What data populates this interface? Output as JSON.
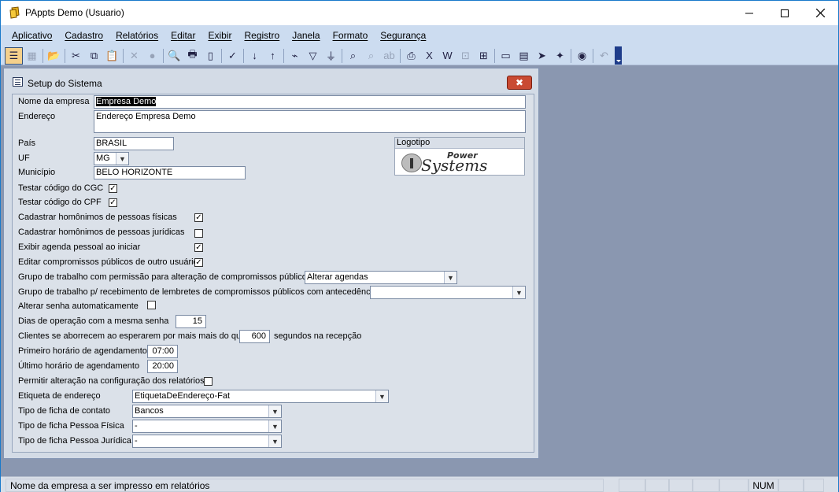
{
  "window": {
    "title": "PAppts Demo (Usuario)"
  },
  "menu": [
    "Aplicativo",
    "Cadastro",
    "Relatórios",
    "Editar",
    "Exibir",
    "Registro",
    "Janela",
    "Formato",
    "Segurança"
  ],
  "child_window": {
    "title": "Setup do Sistema",
    "close_glyph": "✖"
  },
  "form": {
    "nome_empresa": {
      "label": "Nome da empresa",
      "value": "Empresa Demo"
    },
    "endereco": {
      "label": "Endereço",
      "value": "Endereço Empresa Demo"
    },
    "pais": {
      "label": "País",
      "value": "BRASIL"
    },
    "uf": {
      "label": "UF",
      "value": "MG"
    },
    "municipio": {
      "label": "Município",
      "value": "BELO HORIZONTE"
    },
    "logotipo": {
      "label": "Logotipo",
      "logo_power": "Power",
      "logo_systems": "Systems"
    },
    "testar_cgc": {
      "label": "Testar código do CGC",
      "checked": true
    },
    "testar_cpf": {
      "label": "Testar código do CPF",
      "checked": true
    },
    "homonimos_fisicas": {
      "label": "Cadastrar homônimos de pessoas físicas",
      "checked": true
    },
    "homonimos_juridicas": {
      "label": "Cadastrar homônimos de pessoas jurídicas",
      "checked": false
    },
    "exibir_agenda": {
      "label": "Exibir agenda pessoal ao iniciar",
      "checked": true
    },
    "editar_compromissos": {
      "label": "Editar compromissos públicos de outro usuário",
      "checked": true
    },
    "grupo_alteracao": {
      "label": "Grupo de trabalho com permissão para alteração de compromissos públicos",
      "value": "Alterar agendas"
    },
    "grupo_lembretes": {
      "label": "Grupo de trabalho p/ recebimento de lembretes de compromissos públicos com antecedência",
      "value": ""
    },
    "alterar_senha": {
      "label": "Alterar senha automaticamente",
      "checked": false
    },
    "dias_operacao": {
      "label": "Dias de operação com a mesma senha",
      "value": "15"
    },
    "clientes_aborrecem": {
      "label": "Clientes se aborrecem ao esperarem por mais mais do que",
      "value": "600",
      "suffix": "segundos na recepção"
    },
    "primeiro_horario": {
      "label": "Primeiro horário de agendamento",
      "value": "07:00"
    },
    "ultimo_horario": {
      "label": "Último horário de agendamento",
      "value": "20:00"
    },
    "permitir_alteracao": {
      "label": "Permitir alteração na configuração dos relatórios",
      "checked": false
    },
    "etiqueta_endereco": {
      "label": "Etiqueta de endereço",
      "value": "EtiquetaDeEndereço-Fat"
    },
    "tipo_ficha_contato": {
      "label": "Tipo de ficha de contato",
      "value": "Bancos"
    },
    "tipo_ficha_fisica": {
      "label": "Tipo de ficha Pessoa Física",
      "value": "-"
    },
    "tipo_ficha_juridica": {
      "label": "Tipo de ficha Pessoa Jurídica",
      "value": "-"
    }
  },
  "statusbar": {
    "message": "Nome da empresa a ser impresso em relatórios",
    "num": "NUM"
  }
}
